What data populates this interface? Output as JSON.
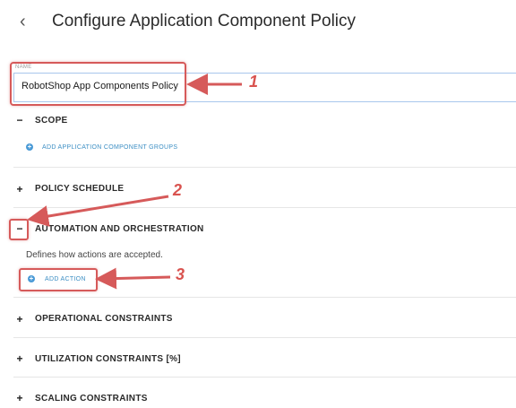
{
  "header": {
    "back_icon": "chevron-left-icon",
    "title": "Configure Application Component Policy"
  },
  "name_field": {
    "label": "NAME",
    "value": "RobotShop App Components Policy"
  },
  "sections": {
    "scope": {
      "toggle": "−",
      "label": "SCOPE",
      "add_link": "ADD APPLICATION COMPONENT GROUPS"
    },
    "policy_schedule": {
      "toggle": "+",
      "label": "POLICY SCHEDULE"
    },
    "automation": {
      "toggle": "−",
      "label": "AUTOMATION AND ORCHESTRATION",
      "description": "Defines how actions are accepted.",
      "add_link": "ADD ACTION"
    },
    "operational": {
      "toggle": "+",
      "label": "OPERATIONAL CONSTRAINTS"
    },
    "utilization": {
      "toggle": "+",
      "label": "UTILIZATION CONSTRAINTS [%]"
    },
    "scaling": {
      "toggle": "+",
      "label": "SCALING CONSTRAINTS"
    }
  },
  "callouts": {
    "one": "1",
    "two": "2",
    "three": "3"
  },
  "colors": {
    "callout_red": "#d65a5a",
    "link_blue": "#3d8fc4",
    "input_border": "#a9c7ec"
  }
}
